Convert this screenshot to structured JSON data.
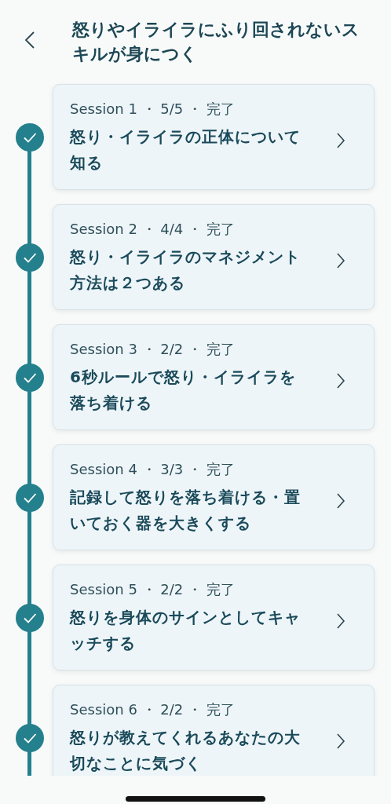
{
  "header": {
    "title": "怒りやイライラにふり回されないスキルが身につく"
  },
  "sessions": [
    {
      "meta": "Session 1 ・ 5/5 ・ 完了",
      "title": "怒り・イライラの正体について知る",
      "completed": true
    },
    {
      "meta": "Session 2 ・ 4/4 ・ 完了",
      "title": "怒り・イライラのマネジメント方法は２つある",
      "completed": true
    },
    {
      "meta": "Session 3 ・ 2/2 ・ 完了",
      "title": "6秒ルールで怒り・イライラを落ち着ける",
      "completed": true
    },
    {
      "meta": "Session 4 ・ 3/3 ・ 完了",
      "title": "記録して怒りを落ち着ける・置いておく器を大きくする",
      "completed": true
    },
    {
      "meta": "Session 5 ・ 2/2 ・ 完了",
      "title": "怒りを身体のサインとしてキャッチする",
      "completed": true
    },
    {
      "meta": "Session 6 ・ 2/2 ・ 完了",
      "title": "怒りが教えてくれるあなたの大切なことに気づく",
      "completed": true
    }
  ]
}
